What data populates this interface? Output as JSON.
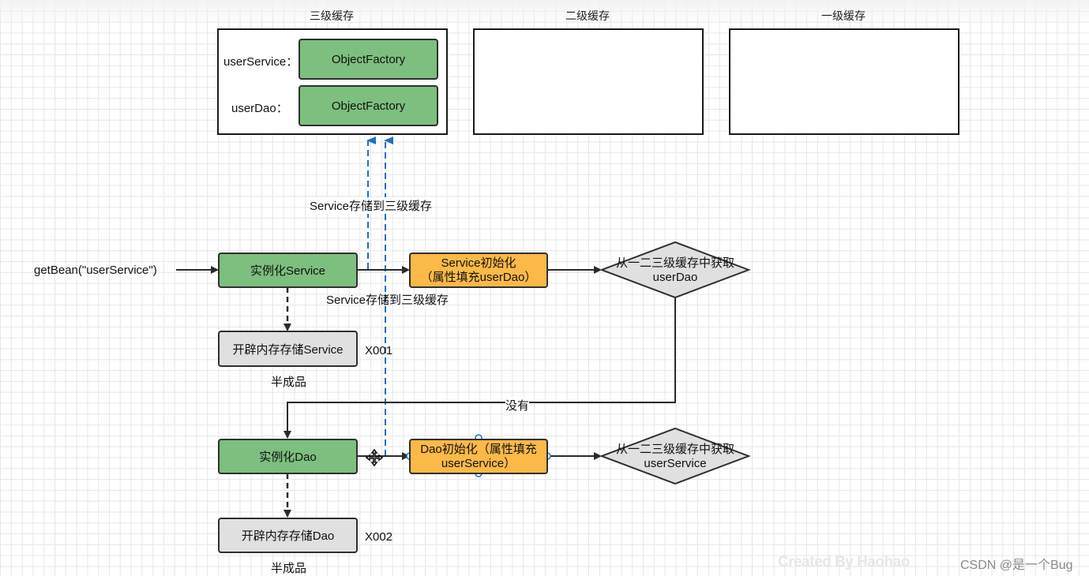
{
  "caches": {
    "third": {
      "title": "三级缓存"
    },
    "second": {
      "title": "二级缓存"
    },
    "first": {
      "title": "一级缓存"
    }
  },
  "third_cache_entries": [
    {
      "key": "userService：",
      "value": "ObjectFactory"
    },
    {
      "key": "userDao：",
      "value": "ObjectFactory"
    }
  ],
  "flow": {
    "start_label": "getBean(\"userService\")",
    "instantiate_service": "实例化Service",
    "service_init_line1": "Service初始化",
    "service_init_line2": "（属性填充userDao）",
    "lookup_dao_line1": "从一二三级缓存中获取",
    "lookup_dao_line2": "userDao",
    "store_service_top": "Service存储到三级缓存",
    "store_service_bottom": "Service存储到三级缓存",
    "alloc_service": "开辟内存存储Service",
    "addr_service": "X001",
    "half_product_1": "半成品",
    "none_label": "没有",
    "instantiate_dao": "实例化Dao",
    "dao_init_line1": "Dao初始化（属性填充",
    "dao_init_line2": "userService）",
    "lookup_service_line1": "从一二三级缓存中获取",
    "lookup_service_line2": "userService",
    "alloc_dao": "开辟内存存储Dao",
    "addr_dao": "X002",
    "half_product_2": "半成品"
  },
  "watermarks": {
    "created_by": "Created By Haohao",
    "csdn": "CSDN @是一个Bug"
  },
  "colors": {
    "green": "#7dbf7e",
    "orange": "#fbb947",
    "gray": "#e0e0e0",
    "blue_dashed": "#1f6fc5"
  }
}
